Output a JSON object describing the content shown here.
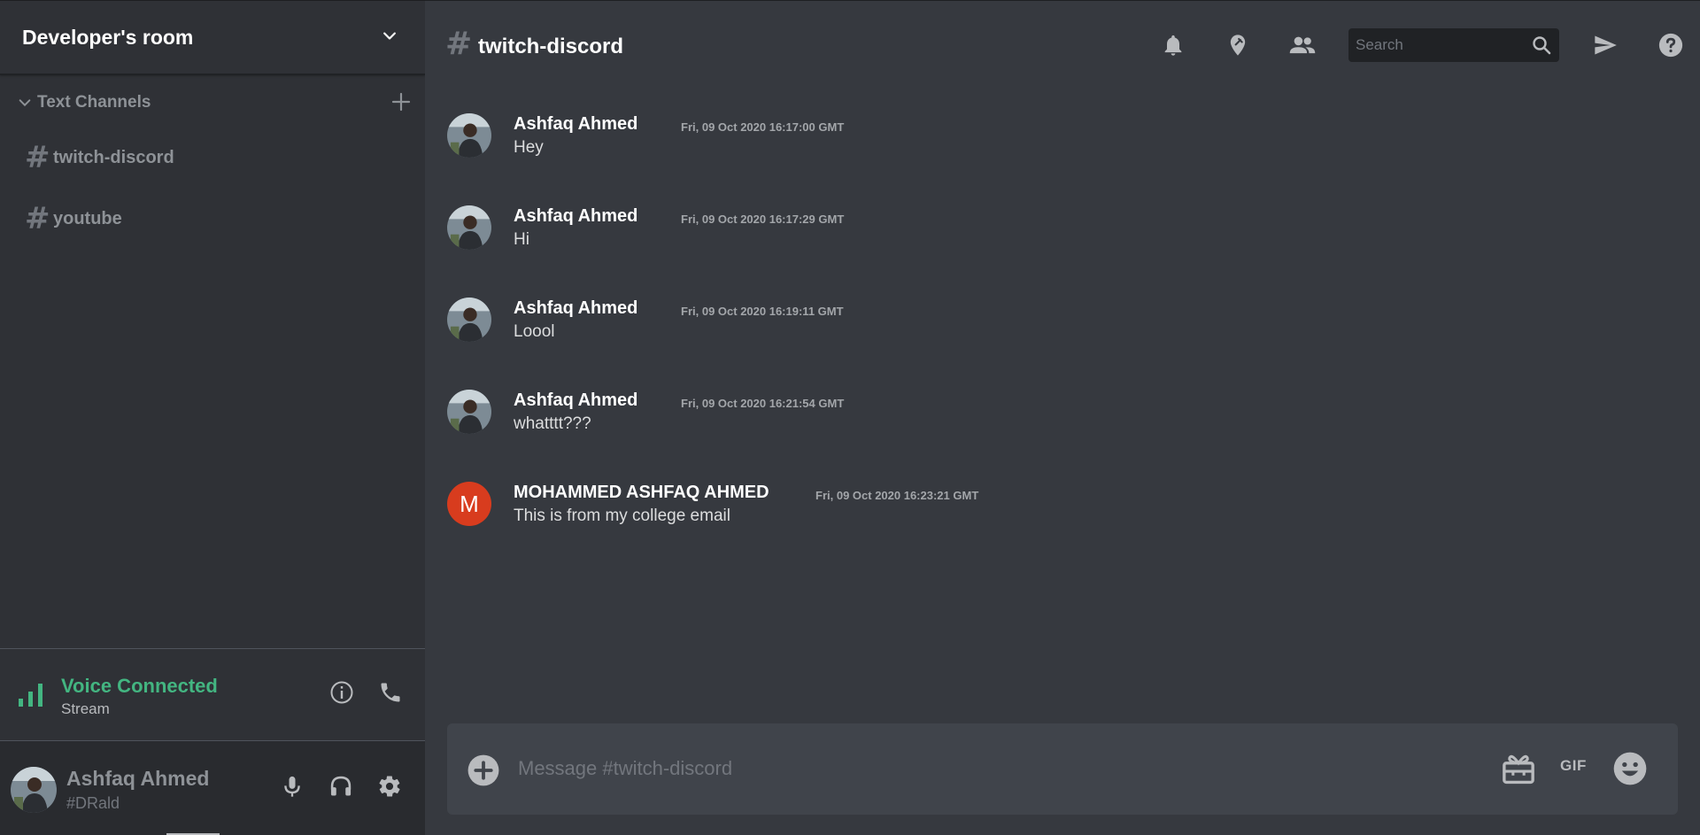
{
  "colors": {
    "sidebar_bg": "#2f3136",
    "main_bg": "#36393f",
    "user_panel_bg": "#292b2f",
    "voice_green": "#43b581",
    "composer_bg": "#40444b",
    "letter_avatar_bg": "#d83c1e"
  },
  "sidebar": {
    "server_name": "Developer's room",
    "category": {
      "label": "Text Channels",
      "chevron_icon": "chevron-down-icon",
      "add_icon": "plus-icon"
    },
    "channels": [
      {
        "hash": "#",
        "name": "twitch-discord"
      },
      {
        "hash": "#",
        "name": "youtube"
      }
    ],
    "voice": {
      "title": "Voice Connected",
      "subtitle": "Stream",
      "icons": [
        "signal-icon",
        "info-icon",
        "phone-icon"
      ]
    },
    "user": {
      "name": "Ashfaq Ahmed",
      "tag": "#DRald",
      "icons": [
        "microphone-icon",
        "headphones-icon",
        "gear-icon"
      ]
    }
  },
  "header": {
    "hash": "#",
    "channel_name": "twitch-discord",
    "search_placeholder": "Search",
    "icons": [
      "bell-icon",
      "pin-icon",
      "members-icon",
      "search-icon",
      "send-icon",
      "help-icon"
    ]
  },
  "messages": [
    {
      "author": "Ashfaq Ahmed",
      "timestamp": "Fri, 09 Oct 2020 16:17:00 GMT",
      "text": "Hey",
      "avatar": "photo"
    },
    {
      "author": "Ashfaq Ahmed",
      "timestamp": "Fri, 09 Oct 2020 16:17:29 GMT",
      "text": "Hi",
      "avatar": "photo"
    },
    {
      "author": "Ashfaq Ahmed",
      "timestamp": "Fri, 09 Oct 2020 16:19:11 GMT",
      "text": "Loool",
      "avatar": "photo"
    },
    {
      "author": "Ashfaq Ahmed",
      "timestamp": "Fri, 09 Oct 2020 16:21:54 GMT",
      "text": "whatttt???",
      "avatar": "photo"
    },
    {
      "author": "MOHAMMED ASHFAQ AHMED",
      "timestamp": "Fri, 09 Oct 2020 16:23:21 GMT",
      "text": "This is from my college email",
      "avatar": "letter",
      "avatar_letter": "M"
    }
  ],
  "composer": {
    "placeholder": "Message #twitch-discord",
    "gif_label": "GIF",
    "icons": [
      "add-circle-icon",
      "gift-icon",
      "emoji-icon"
    ]
  }
}
